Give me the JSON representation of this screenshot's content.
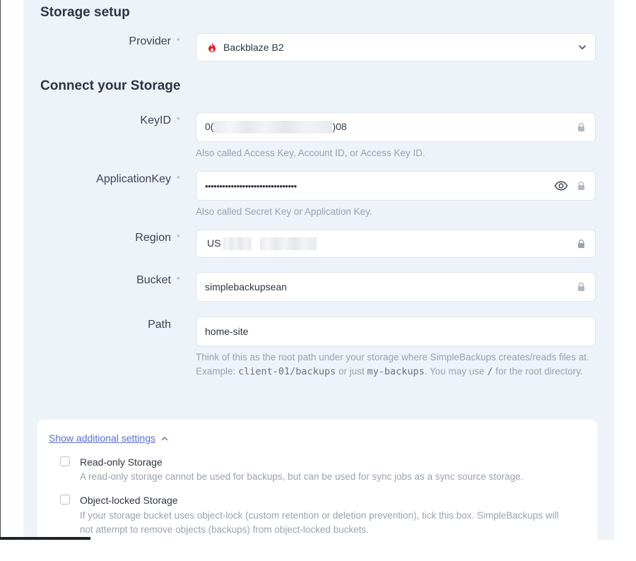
{
  "storage_setup": {
    "title": "Storage setup",
    "provider_label": "Provider",
    "required_mark": "*",
    "provider_value": "Backblaze B2",
    "provider_icon": "backblaze-flame-icon",
    "brand_color": "#e21e29"
  },
  "connect": {
    "title": "Connect your Storage",
    "key_id": {
      "label": "KeyID",
      "value_prefix": "0(",
      "value_suffix": ")08",
      "hint": "Also called Access Key, Account ID, or Access Key ID."
    },
    "application_key": {
      "label": "ApplicationKey",
      "value": "••••••••••••••••••••••••••••••••",
      "hint": "Also called Secret Key or Application Key."
    },
    "region": {
      "label": "Region",
      "value_prefix": "US"
    },
    "bucket": {
      "label": "Bucket",
      "value": "simplebackupsean"
    },
    "path": {
      "label": "Path",
      "value": "home-site",
      "hint_line1": "Think of this as the root path under your storage where SimpleBackups creates/reads files at.",
      "hint_example_prefix": "Example: ",
      "hint_example_code1": "client-01/backups",
      "hint_or": " or just ",
      "hint_example_code2": "my-backups",
      "hint_may_use": ". You may use ",
      "hint_slash": "/",
      "hint_for_root": " for the root directory."
    }
  },
  "additional": {
    "toggle_label": "Show additional settings",
    "read_only": {
      "title": "Read-only Storage",
      "desc": "A read-only storage cannot be used for backups, but can be used for sync jobs as a sync source storage."
    },
    "object_locked": {
      "title": "Object-locked Storage",
      "desc": "If your storage bucket uses object-lock (custom retention or deletion prevention), tick this box. SimpleBackups will not attempt to remove objects (backups) from object-locked buckets."
    }
  }
}
